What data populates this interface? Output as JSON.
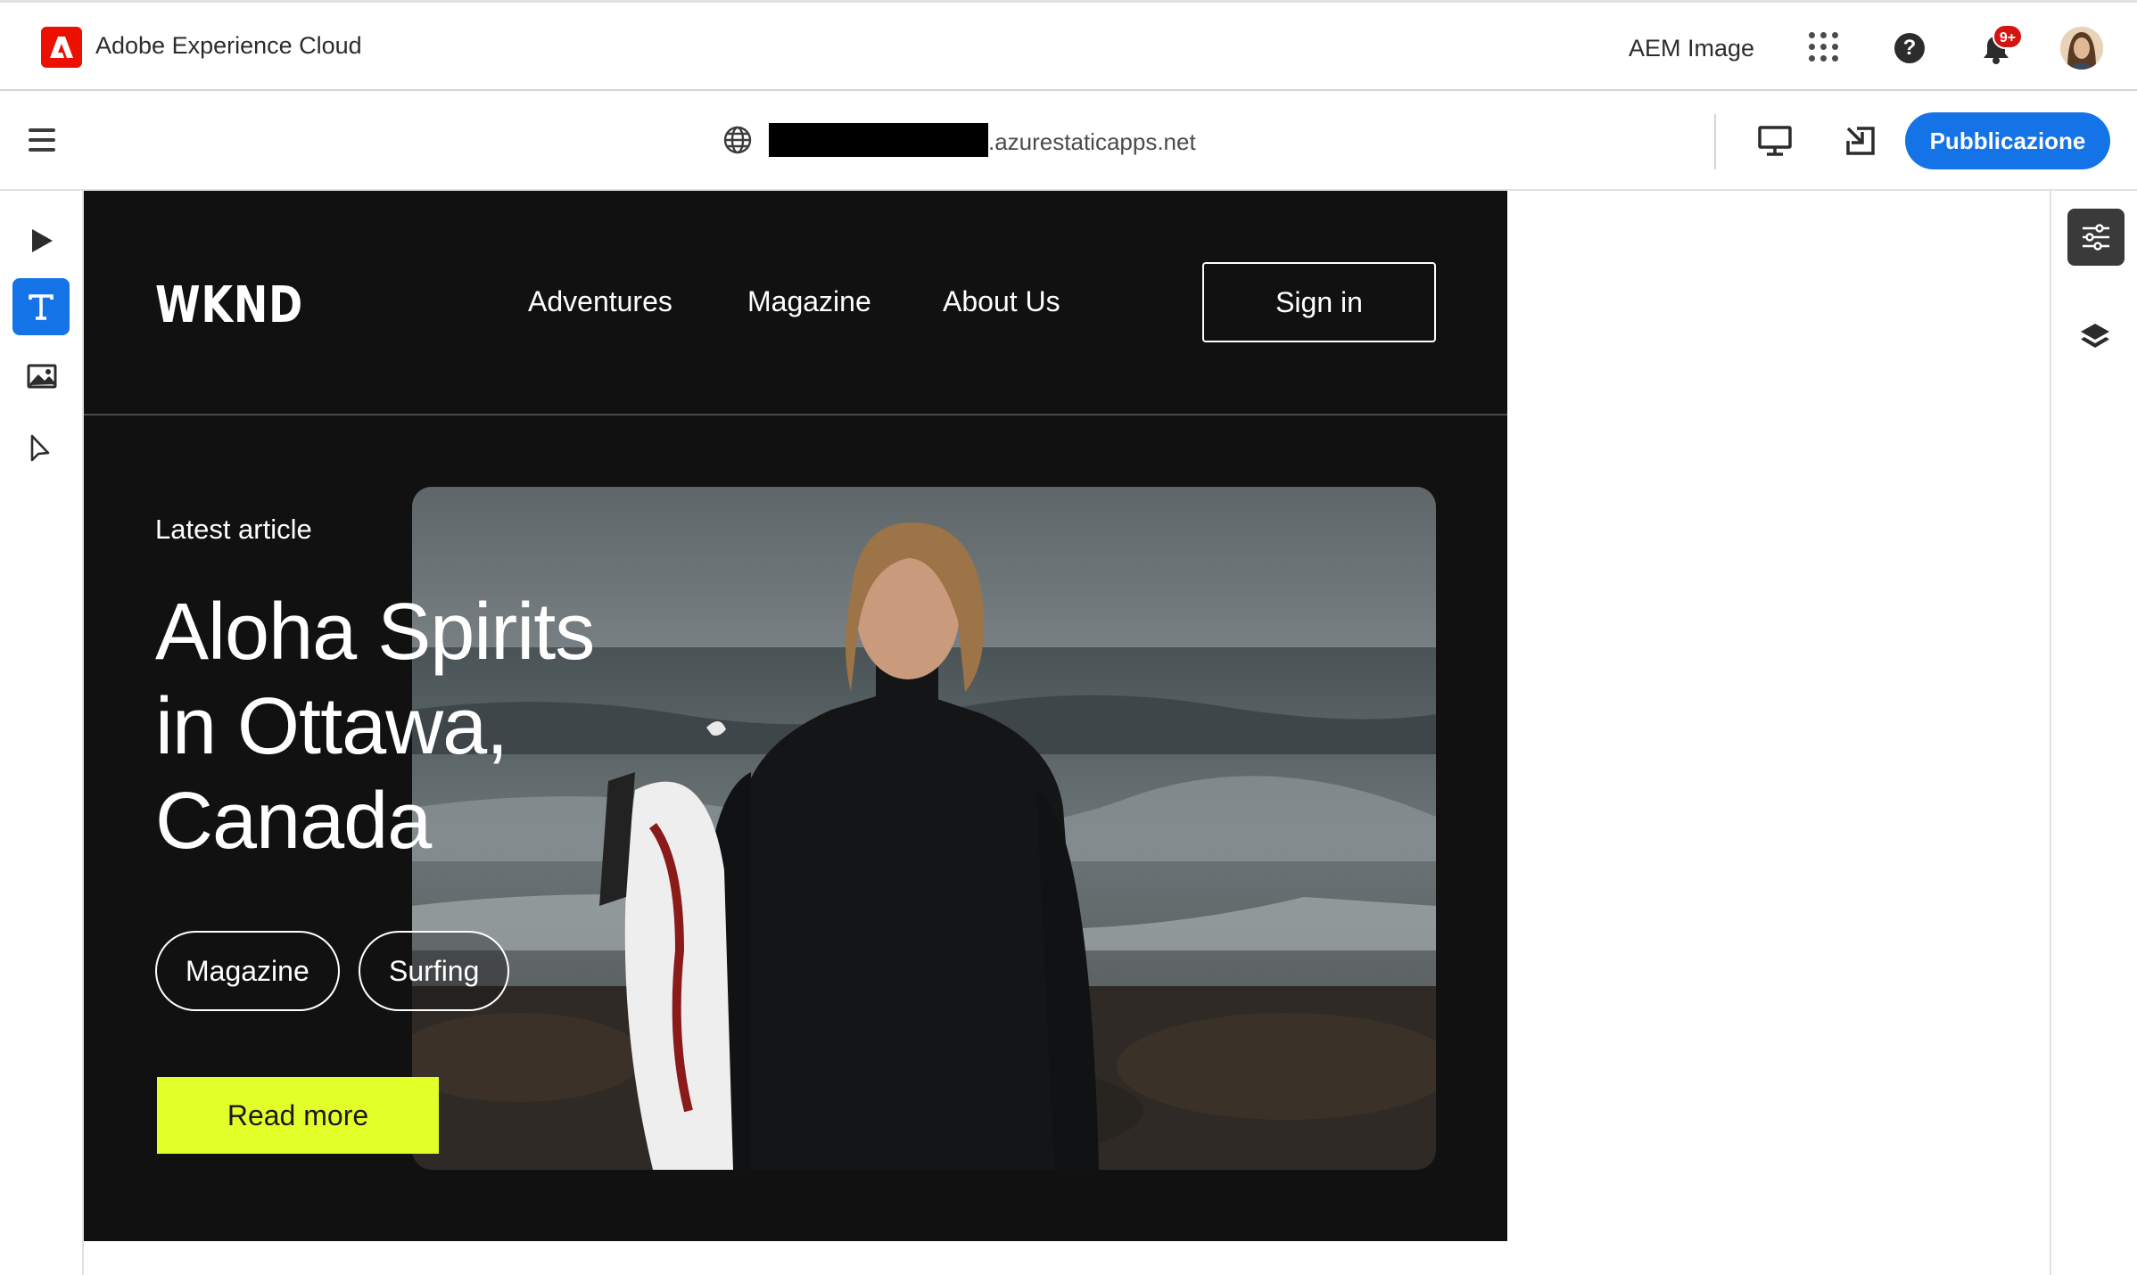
{
  "shell": {
    "brand": "Adobe Experience Cloud",
    "org": "AEM Image",
    "notification_badge": "9+",
    "icons": [
      "adobe-logo-icon",
      "apps-grid-icon",
      "help-icon",
      "bell-icon",
      "user-avatar"
    ]
  },
  "toolbar": {
    "url_suffix": ".azurestaticapps.net",
    "publish_label": "Pubblicazione",
    "icons": [
      "menu-icon",
      "globe-icon",
      "desktop-icon",
      "open-external-icon"
    ]
  },
  "left_rail": {
    "tools": [
      "preview-play-icon",
      "text-tool-icon",
      "image-tool-icon",
      "select-pointer-icon"
    ],
    "active_tool": "text-tool-icon"
  },
  "right_rail": {
    "icons": [
      "properties-sliders-icon",
      "layers-icon"
    ]
  },
  "site": {
    "logo": "WKND",
    "nav": [
      "Adventures",
      "Magazine",
      "About Us"
    ],
    "signin_label": "Sign in",
    "eyebrow": "Latest article",
    "title_lines": [
      "Aloha Spirits",
      "in Ottawa,",
      "Canada"
    ],
    "tags": [
      "Magazine",
      "Surfing"
    ],
    "cta_label": "Read more",
    "accent_color": "#e3ff2a"
  },
  "colors": {
    "publish_blue": "#1473e6",
    "adobe_red": "#eb1000",
    "site_background": "#111111"
  }
}
